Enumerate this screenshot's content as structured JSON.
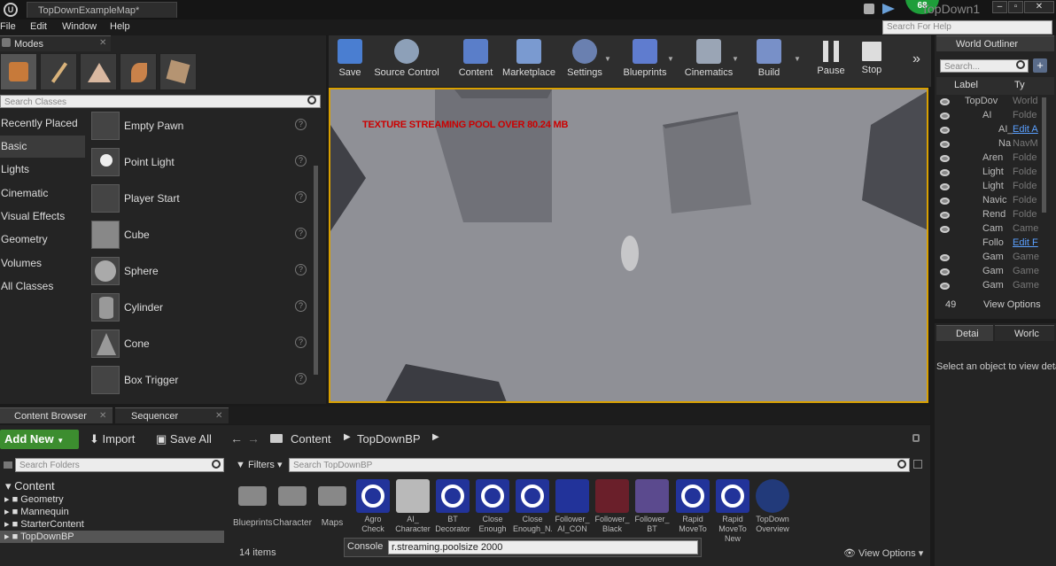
{
  "window": {
    "doc_tab": "TopDownExampleMap*",
    "project": "TopDown1",
    "fps": "68"
  },
  "menu": [
    "File",
    "Edit",
    "Window",
    "Help"
  ],
  "search_help": {
    "placeholder": "Search For Help"
  },
  "modes_panel": {
    "title": "Modes",
    "search_placeholder": "Search Classes",
    "categories": [
      "Recently Placed",
      "Basic",
      "Lights",
      "Cinematic",
      "Visual Effects",
      "Geometry",
      "Volumes",
      "All Classes"
    ],
    "selected_category": "Basic",
    "items": [
      "Empty Pawn",
      "Point Light",
      "Player Start",
      "Cube",
      "Sphere",
      "Cylinder",
      "Cone",
      "Box Trigger"
    ]
  },
  "toolbar": {
    "buttons": [
      "Save",
      "Source Control",
      "Content",
      "Marketplace",
      "Settings",
      "Blueprints",
      "Cinematics",
      "Build",
      "Pause",
      "Stop"
    ]
  },
  "viewport": {
    "message": "TEXTURE STREAMING POOL OVER 80.24 MB"
  },
  "outliner": {
    "title": "World Outliner",
    "search_placeholder": "Search...",
    "col_label": "Label",
    "col_type": "Ty",
    "rows": [
      {
        "label": "TopDov",
        "type": "World"
      },
      {
        "label": "AI",
        "type": "Folde"
      },
      {
        "label": "AI_",
        "type": "Edit A"
      },
      {
        "label": "Na",
        "type": "NavM"
      },
      {
        "label": "Aren",
        "type": "Folde"
      },
      {
        "label": "Light",
        "type": "Folde"
      },
      {
        "label": "Light",
        "type": "Folde"
      },
      {
        "label": "Navic",
        "type": "Folde"
      },
      {
        "label": "Rend",
        "type": "Folde"
      },
      {
        "label": "Cam",
        "type": "Came"
      },
      {
        "label": "Follo",
        "type": "Edit F"
      },
      {
        "label": "Gam",
        "type": "Game"
      },
      {
        "label": "Gam",
        "type": "Game"
      },
      {
        "label": "Gam",
        "type": "Game"
      }
    ],
    "count": "49",
    "view_options": "View Options"
  },
  "details": {
    "tab1": "Detai",
    "tab2": "Worlc",
    "empty_msg": "Select an object to view deta"
  },
  "bottom_tabs": {
    "content_browser": "Content Browser",
    "sequencer": "Sequencer"
  },
  "content_browser": {
    "add_new": "Add New",
    "import": "Import",
    "save_all": "Save All",
    "path": [
      "Content",
      "TopDownBP"
    ],
    "search_folders": "Search Folders",
    "filters": "Filters",
    "search_assets": "Search TopDownBP",
    "tree": [
      "Content",
      "Geometry",
      "Mannequin",
      "StarterContent",
      "TopDownBP"
    ],
    "assets": [
      {
        "name": "Blueprints",
        "kind": "folder"
      },
      {
        "name": "Character",
        "kind": "folder"
      },
      {
        "name": "Maps",
        "kind": "folder"
      },
      {
        "name": "Agro Check",
        "kind": "ring"
      },
      {
        "name": "AI_ Character",
        "kind": "char"
      },
      {
        "name": "BT Decorator",
        "kind": "ring"
      },
      {
        "name": "Close Enough",
        "kind": "ring"
      },
      {
        "name": "Close Enough_N...",
        "kind": "ring"
      },
      {
        "name": "Follower_ AI_CON",
        "kind": "pawn"
      },
      {
        "name": "Follower_ Black",
        "kind": "board"
      },
      {
        "name": "Follower_ BT",
        "kind": "tree"
      },
      {
        "name": "Rapid MoveTo",
        "kind": "ring"
      },
      {
        "name": "Rapid MoveTo New",
        "kind": "ring"
      },
      {
        "name": "TopDown Overview",
        "kind": "play"
      }
    ],
    "item_count": "14 items",
    "view_options": "View Options",
    "console_label": "Console",
    "console_value": "r.streaming.poolsize 2000"
  },
  "colors": {
    "accent": "#d9a000",
    "add_new": "#3c8d2f",
    "viewport_bg": "#8e8f95"
  }
}
